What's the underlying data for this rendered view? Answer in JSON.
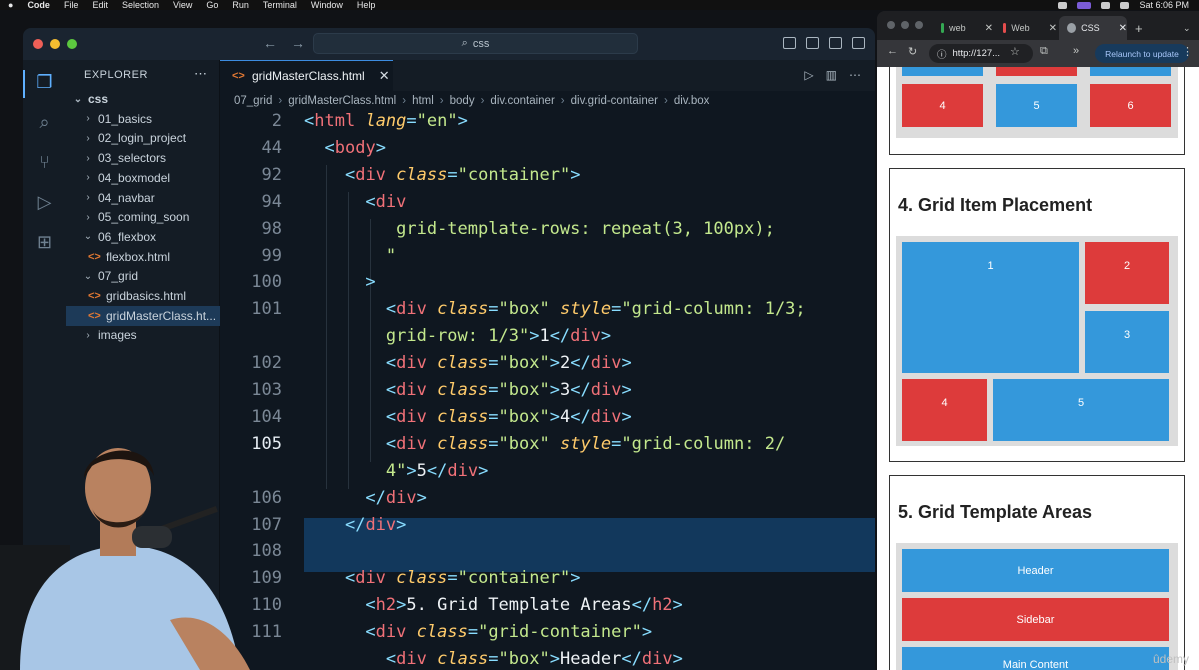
{
  "menubar": {
    "app": "Code",
    "items": [
      "File",
      "Edit",
      "Selection",
      "View",
      "Go",
      "Run",
      "Terminal",
      "Window",
      "Help"
    ],
    "clock": "Sat 6:06 PM"
  },
  "vscode": {
    "search_text": "css",
    "explorer_title": "EXPLORER",
    "tree": [
      {
        "label": "css",
        "level": 0,
        "kind": "folder-open"
      },
      {
        "label": "01_basics",
        "level": 1,
        "kind": "folder"
      },
      {
        "label": "02_login_project",
        "level": 1,
        "kind": "folder"
      },
      {
        "label": "03_selectors",
        "level": 1,
        "kind": "folder"
      },
      {
        "label": "04_boxmodel",
        "level": 1,
        "kind": "folder"
      },
      {
        "label": "04_navbar",
        "level": 1,
        "kind": "folder"
      },
      {
        "label": "05_coming_soon",
        "level": 1,
        "kind": "folder"
      },
      {
        "label": "06_flexbox",
        "level": 1,
        "kind": "folder-open"
      },
      {
        "label": "flexbox.html",
        "level": 2,
        "kind": "file"
      },
      {
        "label": "07_grid",
        "level": 1,
        "kind": "folder-open"
      },
      {
        "label": "gridbasics.html",
        "level": 2,
        "kind": "file"
      },
      {
        "label": "gridMasterClass.ht...",
        "level": 2,
        "kind": "file",
        "selected": true
      },
      {
        "label": "images",
        "level": 1,
        "kind": "folder"
      }
    ],
    "active_tab": "gridMasterClass.html",
    "breadcrumb": [
      "07_grid",
      "gridMasterClass.html",
      "html",
      "body",
      "div.container",
      "div.grid-container",
      "div.box"
    ],
    "current_line": "105",
    "code_lines": [
      {
        "num": "2",
        "tokens": [
          [
            "pun",
            "<"
          ],
          [
            "tag",
            "html"
          ],
          [
            "txt",
            " "
          ],
          [
            "attr",
            "lang"
          ],
          [
            "pun",
            "="
          ],
          [
            "str",
            "\"en\""
          ],
          [
            "pun",
            ">"
          ]
        ]
      },
      {
        "num": "44",
        "tokens": [
          [
            "txt",
            "  "
          ],
          [
            "pun",
            "<"
          ],
          [
            "tag",
            "body"
          ],
          [
            "pun",
            ">"
          ]
        ]
      },
      {
        "num": "92",
        "tokens": [
          [
            "txt",
            "    "
          ],
          [
            "pun",
            "<"
          ],
          [
            "tag",
            "div"
          ],
          [
            "txt",
            " "
          ],
          [
            "attr",
            "class"
          ],
          [
            "pun",
            "="
          ],
          [
            "str",
            "\"container\""
          ],
          [
            "pun",
            ">"
          ]
        ]
      },
      {
        "num": "94",
        "tokens": [
          [
            "txt",
            "      "
          ],
          [
            "pun",
            "<"
          ],
          [
            "tag",
            "div"
          ]
        ]
      },
      {
        "num": "98",
        "tokens": [
          [
            "txt",
            "         "
          ],
          [
            "str",
            "grid-template-rows: repeat(3, 100px);"
          ]
        ]
      },
      {
        "num": "99",
        "tokens": [
          [
            "txt",
            "        "
          ],
          [
            "str",
            "\""
          ]
        ]
      },
      {
        "num": "100",
        "tokens": [
          [
            "txt",
            "      "
          ],
          [
            "pun",
            ">"
          ]
        ]
      },
      {
        "num": "101",
        "tokens": [
          [
            "txt",
            "        "
          ],
          [
            "pun",
            "<"
          ],
          [
            "tag",
            "div"
          ],
          [
            "txt",
            " "
          ],
          [
            "attr",
            "class"
          ],
          [
            "pun",
            "="
          ],
          [
            "str",
            "\"box\""
          ],
          [
            "txt",
            " "
          ],
          [
            "attr",
            "style"
          ],
          [
            "pun",
            "="
          ],
          [
            "str",
            "\"grid-column: 1/3;"
          ]
        ]
      },
      {
        "num": "",
        "tokens": [
          [
            "txt",
            "        "
          ],
          [
            "str",
            "grid-row: 1/3\""
          ],
          [
            "pun",
            ">"
          ],
          [
            "txt",
            "1"
          ],
          [
            "pun",
            "</"
          ],
          [
            "tag",
            "div"
          ],
          [
            "pun",
            ">"
          ]
        ]
      },
      {
        "num": "102",
        "tokens": [
          [
            "txt",
            "        "
          ],
          [
            "pun",
            "<"
          ],
          [
            "tag",
            "div"
          ],
          [
            "txt",
            " "
          ],
          [
            "attr",
            "class"
          ],
          [
            "pun",
            "="
          ],
          [
            "str",
            "\"box\""
          ],
          [
            "pun",
            ">"
          ],
          [
            "txt",
            "2"
          ],
          [
            "pun",
            "</"
          ],
          [
            "tag",
            "div"
          ],
          [
            "pun",
            ">"
          ]
        ]
      },
      {
        "num": "103",
        "tokens": [
          [
            "txt",
            "        "
          ],
          [
            "pun",
            "<"
          ],
          [
            "tag",
            "div"
          ],
          [
            "txt",
            " "
          ],
          [
            "attr",
            "class"
          ],
          [
            "pun",
            "="
          ],
          [
            "str",
            "\"box\""
          ],
          [
            "pun",
            ">"
          ],
          [
            "txt",
            "3"
          ],
          [
            "pun",
            "</"
          ],
          [
            "tag",
            "div"
          ],
          [
            "pun",
            ">"
          ]
        ]
      },
      {
        "num": "104",
        "tokens": [
          [
            "txt",
            "        "
          ],
          [
            "pun",
            "<"
          ],
          [
            "tag",
            "div"
          ],
          [
            "txt",
            " "
          ],
          [
            "attr",
            "class"
          ],
          [
            "pun",
            "="
          ],
          [
            "str",
            "\"box\""
          ],
          [
            "pun",
            ">"
          ],
          [
            "txt",
            "4"
          ],
          [
            "pun",
            "</"
          ],
          [
            "tag",
            "div"
          ],
          [
            "pun",
            ">"
          ]
        ]
      },
      {
        "num": "105",
        "tokens": [
          [
            "txt",
            "        "
          ],
          [
            "pun",
            "<"
          ],
          [
            "tag",
            "div"
          ],
          [
            "txt",
            " "
          ],
          [
            "attr",
            "class"
          ],
          [
            "pun",
            "="
          ],
          [
            "str",
            "\"box\""
          ],
          [
            "txt",
            " "
          ],
          [
            "attr",
            "style"
          ],
          [
            "pun",
            "="
          ],
          [
            "str",
            "\"grid-column: 2/"
          ]
        ]
      },
      {
        "num": "",
        "tokens": [
          [
            "txt",
            "        "
          ],
          [
            "str",
            "4\""
          ],
          [
            "pun",
            ">"
          ],
          [
            "txt",
            "5"
          ],
          [
            "pun",
            "</"
          ],
          [
            "tag",
            "div"
          ],
          [
            "pun",
            ">"
          ]
        ]
      },
      {
        "num": "106",
        "tokens": [
          [
            "txt",
            "      "
          ],
          [
            "pun",
            "</"
          ],
          [
            "tag",
            "div"
          ],
          [
            "pun",
            ">"
          ]
        ]
      },
      {
        "num": "107",
        "tokens": [
          [
            "txt",
            "    "
          ],
          [
            "pun",
            "</"
          ],
          [
            "tag",
            "div"
          ],
          [
            "pun",
            ">"
          ]
        ]
      },
      {
        "num": "108",
        "tokens": []
      },
      {
        "num": "109",
        "tokens": [
          [
            "txt",
            "    "
          ],
          [
            "pun",
            "<"
          ],
          [
            "tag",
            "div"
          ],
          [
            "txt",
            " "
          ],
          [
            "attr",
            "class"
          ],
          [
            "pun",
            "="
          ],
          [
            "str",
            "\"container\""
          ],
          [
            "pun",
            ">"
          ]
        ]
      },
      {
        "num": "110",
        "tokens": [
          [
            "txt",
            "      "
          ],
          [
            "pun",
            "<"
          ],
          [
            "tag",
            "h2"
          ],
          [
            "pun",
            ">"
          ],
          [
            "txt",
            "5. Grid Template Areas"
          ],
          [
            "pun",
            "</"
          ],
          [
            "tag",
            "h2"
          ],
          [
            "pun",
            ">"
          ]
        ]
      },
      {
        "num": "111",
        "tokens": [
          [
            "txt",
            "      "
          ],
          [
            "pun",
            "<"
          ],
          [
            "tag",
            "div"
          ],
          [
            "txt",
            " "
          ],
          [
            "attr",
            "class"
          ],
          [
            "pun",
            "="
          ],
          [
            "str",
            "\"grid-container\""
          ],
          [
            "pun",
            ">"
          ]
        ]
      },
      {
        "num": "",
        "tokens": [
          [
            "txt",
            "        "
          ],
          [
            "pun",
            "<"
          ],
          [
            "tag",
            "div"
          ],
          [
            "txt",
            " "
          ],
          [
            "attr",
            "class"
          ],
          [
            "pun",
            "="
          ],
          [
            "str",
            "\"box\""
          ],
          [
            "pun",
            ">"
          ],
          [
            "txt",
            "Header"
          ],
          [
            "pun",
            "</"
          ],
          [
            "tag",
            "div"
          ],
          [
            "pun",
            ">"
          ]
        ]
      }
    ]
  },
  "browser": {
    "tabs": [
      "web",
      "Web",
      "CSS"
    ],
    "url": "http://127...",
    "relaunch_label": "Relaunch to update",
    "top_boxes": [
      "4",
      "5",
      "6"
    ],
    "section4_title": "4. Grid Item Placement",
    "section4_boxes": [
      "1",
      "2",
      "3",
      "4",
      "5"
    ],
    "section5_title": "5. Grid Template Areas",
    "section5_boxes": [
      "Header",
      "Sidebar",
      "Main Content"
    ]
  },
  "watermark": "ûdemy",
  "colors": {
    "box_blue": "#3498db",
    "box_red": "#dd3b3b",
    "accent": "#3c8ce0"
  }
}
